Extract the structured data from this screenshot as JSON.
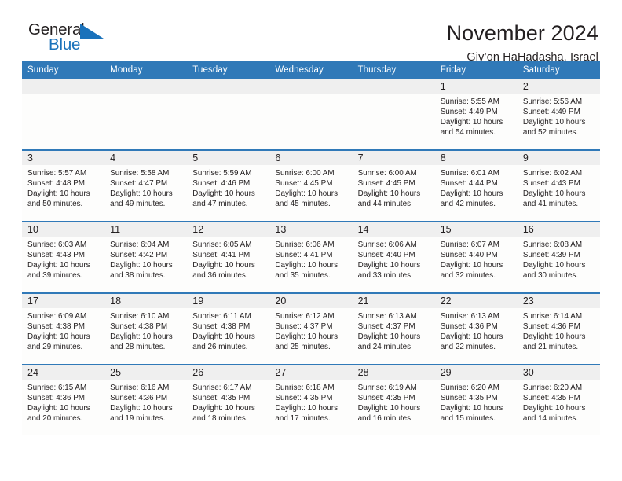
{
  "brand": {
    "word_one": "General",
    "word_two": "Blue",
    "mark": "triangle-flag-icon",
    "accent_color": "#1a72bb"
  },
  "header": {
    "title": "November 2024",
    "subtitle": "Giv’on HaHadasha, Israel"
  },
  "theme": {
    "header_blue": "#3079b8",
    "daynum_gray": "#efefef",
    "cell_white": "#fdfdfc",
    "text": "#231f20"
  },
  "calendar": {
    "weekdays": [
      "Sunday",
      "Monday",
      "Tuesday",
      "Wednesday",
      "Thursday",
      "Friday",
      "Saturday"
    ],
    "weeks": [
      [
        {
          "day": "",
          "empty": true
        },
        {
          "day": "",
          "empty": true
        },
        {
          "day": "",
          "empty": true
        },
        {
          "day": "",
          "empty": true
        },
        {
          "day": "",
          "empty": true
        },
        {
          "day": "1",
          "sunrise": "Sunrise: 5:55 AM",
          "sunset": "Sunset: 4:49 PM",
          "daylight": "Daylight: 10 hours and 54 minutes."
        },
        {
          "day": "2",
          "sunrise": "Sunrise: 5:56 AM",
          "sunset": "Sunset: 4:49 PM",
          "daylight": "Daylight: 10 hours and 52 minutes."
        }
      ],
      [
        {
          "day": "3",
          "sunrise": "Sunrise: 5:57 AM",
          "sunset": "Sunset: 4:48 PM",
          "daylight": "Daylight: 10 hours and 50 minutes."
        },
        {
          "day": "4",
          "sunrise": "Sunrise: 5:58 AM",
          "sunset": "Sunset: 4:47 PM",
          "daylight": "Daylight: 10 hours and 49 minutes."
        },
        {
          "day": "5",
          "sunrise": "Sunrise: 5:59 AM",
          "sunset": "Sunset: 4:46 PM",
          "daylight": "Daylight: 10 hours and 47 minutes."
        },
        {
          "day": "6",
          "sunrise": "Sunrise: 6:00 AM",
          "sunset": "Sunset: 4:45 PM",
          "daylight": "Daylight: 10 hours and 45 minutes."
        },
        {
          "day": "7",
          "sunrise": "Sunrise: 6:00 AM",
          "sunset": "Sunset: 4:45 PM",
          "daylight": "Daylight: 10 hours and 44 minutes."
        },
        {
          "day": "8",
          "sunrise": "Sunrise: 6:01 AM",
          "sunset": "Sunset: 4:44 PM",
          "daylight": "Daylight: 10 hours and 42 minutes."
        },
        {
          "day": "9",
          "sunrise": "Sunrise: 6:02 AM",
          "sunset": "Sunset: 4:43 PM",
          "daylight": "Daylight: 10 hours and 41 minutes."
        }
      ],
      [
        {
          "day": "10",
          "sunrise": "Sunrise: 6:03 AM",
          "sunset": "Sunset: 4:43 PM",
          "daylight": "Daylight: 10 hours and 39 minutes."
        },
        {
          "day": "11",
          "sunrise": "Sunrise: 6:04 AM",
          "sunset": "Sunset: 4:42 PM",
          "daylight": "Daylight: 10 hours and 38 minutes."
        },
        {
          "day": "12",
          "sunrise": "Sunrise: 6:05 AM",
          "sunset": "Sunset: 4:41 PM",
          "daylight": "Daylight: 10 hours and 36 minutes."
        },
        {
          "day": "13",
          "sunrise": "Sunrise: 6:06 AM",
          "sunset": "Sunset: 4:41 PM",
          "daylight": "Daylight: 10 hours and 35 minutes."
        },
        {
          "day": "14",
          "sunrise": "Sunrise: 6:06 AM",
          "sunset": "Sunset: 4:40 PM",
          "daylight": "Daylight: 10 hours and 33 minutes."
        },
        {
          "day": "15",
          "sunrise": "Sunrise: 6:07 AM",
          "sunset": "Sunset: 4:40 PM",
          "daylight": "Daylight: 10 hours and 32 minutes."
        },
        {
          "day": "16",
          "sunrise": "Sunrise: 6:08 AM",
          "sunset": "Sunset: 4:39 PM",
          "daylight": "Daylight: 10 hours and 30 minutes."
        }
      ],
      [
        {
          "day": "17",
          "sunrise": "Sunrise: 6:09 AM",
          "sunset": "Sunset: 4:38 PM",
          "daylight": "Daylight: 10 hours and 29 minutes."
        },
        {
          "day": "18",
          "sunrise": "Sunrise: 6:10 AM",
          "sunset": "Sunset: 4:38 PM",
          "daylight": "Daylight: 10 hours and 28 minutes."
        },
        {
          "day": "19",
          "sunrise": "Sunrise: 6:11 AM",
          "sunset": "Sunset: 4:38 PM",
          "daylight": "Daylight: 10 hours and 26 minutes."
        },
        {
          "day": "20",
          "sunrise": "Sunrise: 6:12 AM",
          "sunset": "Sunset: 4:37 PM",
          "daylight": "Daylight: 10 hours and 25 minutes."
        },
        {
          "day": "21",
          "sunrise": "Sunrise: 6:13 AM",
          "sunset": "Sunset: 4:37 PM",
          "daylight": "Daylight: 10 hours and 24 minutes."
        },
        {
          "day": "22",
          "sunrise": "Sunrise: 6:13 AM",
          "sunset": "Sunset: 4:36 PM",
          "daylight": "Daylight: 10 hours and 22 minutes."
        },
        {
          "day": "23",
          "sunrise": "Sunrise: 6:14 AM",
          "sunset": "Sunset: 4:36 PM",
          "daylight": "Daylight: 10 hours and 21 minutes."
        }
      ],
      [
        {
          "day": "24",
          "sunrise": "Sunrise: 6:15 AM",
          "sunset": "Sunset: 4:36 PM",
          "daylight": "Daylight: 10 hours and 20 minutes."
        },
        {
          "day": "25",
          "sunrise": "Sunrise: 6:16 AM",
          "sunset": "Sunset: 4:36 PM",
          "daylight": "Daylight: 10 hours and 19 minutes."
        },
        {
          "day": "26",
          "sunrise": "Sunrise: 6:17 AM",
          "sunset": "Sunset: 4:35 PM",
          "daylight": "Daylight: 10 hours and 18 minutes."
        },
        {
          "day": "27",
          "sunrise": "Sunrise: 6:18 AM",
          "sunset": "Sunset: 4:35 PM",
          "daylight": "Daylight: 10 hours and 17 minutes."
        },
        {
          "day": "28",
          "sunrise": "Sunrise: 6:19 AM",
          "sunset": "Sunset: 4:35 PM",
          "daylight": "Daylight: 10 hours and 16 minutes."
        },
        {
          "day": "29",
          "sunrise": "Sunrise: 6:20 AM",
          "sunset": "Sunset: 4:35 PM",
          "daylight": "Daylight: 10 hours and 15 minutes."
        },
        {
          "day": "30",
          "sunrise": "Sunrise: 6:20 AM",
          "sunset": "Sunset: 4:35 PM",
          "daylight": "Daylight: 10 hours and 14 minutes."
        }
      ]
    ]
  }
}
